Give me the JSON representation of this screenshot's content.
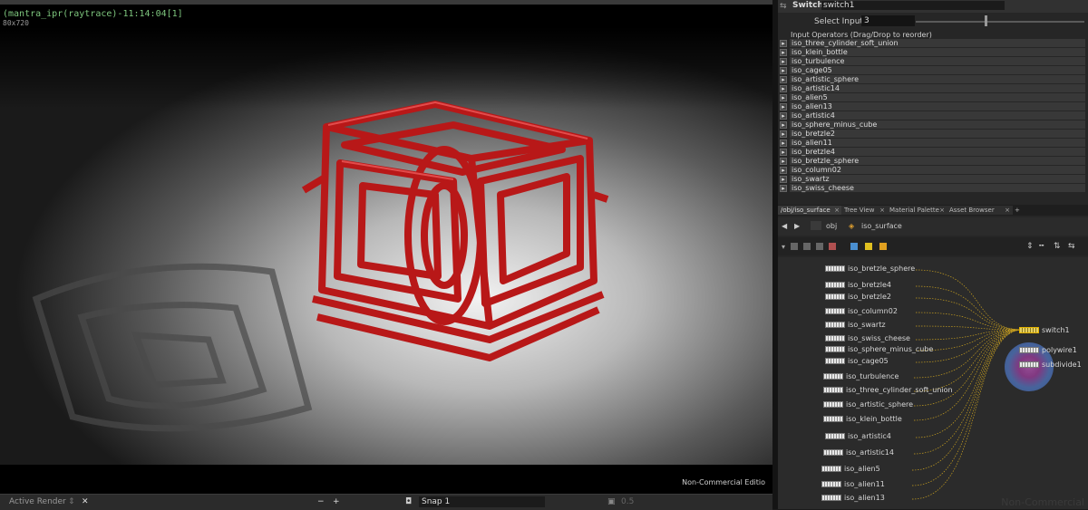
{
  "viewer": {
    "title": "(mantra_ipr(raytrace)-11:14:04[1]",
    "resolution": "80x720",
    "watermark": "Non-Commercial Editio",
    "bottom": {
      "active_render": "Active Render",
      "minus": "−",
      "plus": "+",
      "snap": "Snap 1",
      "zoom": "0.5"
    }
  },
  "params": {
    "op_type": "Switch",
    "op_name": "switch1",
    "select_input_label": "Select Input",
    "select_input_value": "3",
    "select_input_level": 0.41,
    "inputs_header": "Input Operators (Drag/Drop to reorder)",
    "inputs": [
      "iso_three_cylinder_soft_union",
      "iso_klein_bottle",
      "iso_turbulence",
      "iso_cage05",
      "iso_artistic_sphere",
      "iso_artistic14",
      "iso_alien5",
      "iso_alien13",
      "iso_artistic4",
      "iso_sphere_minus_cube",
      "iso_bretzle2",
      "iso_alien11",
      "iso_bretzle4",
      "iso_bretzle_sphere",
      "iso_column02",
      "iso_swartz",
      "iso_swiss_cheese"
    ]
  },
  "pane_tabs": [
    {
      "label": "/obj/iso_surface",
      "active": true
    },
    {
      "label": "Tree View",
      "active": false
    },
    {
      "label": "Material Palette",
      "active": false
    },
    {
      "label": "Asset Browser",
      "active": false
    }
  ],
  "add_tab": "+",
  "path": {
    "root": "obj",
    "current": "iso_surface"
  },
  "network": {
    "nodes": [
      "iso_bretzle_sphere",
      "iso_bretzle4",
      "iso_bretzle2",
      "iso_column02",
      "iso_swartz",
      "iso_swiss_cheese",
      "iso_sphere_minus_cube",
      "iso_cage05",
      "iso_turbulence",
      "iso_three_cylinder_soft_union",
      "iso_artistic_sphere",
      "iso_klein_bottle",
      "iso_artistic4",
      "iso_artistic14",
      "iso_alien5",
      "iso_alien11",
      "iso_alien13"
    ],
    "switch_node": "switch1",
    "polywire_node": "polywire1",
    "subdivide_node": "subdivide1",
    "wire_color": "#c8a020"
  },
  "corner_watermark": "Non-Commercial"
}
